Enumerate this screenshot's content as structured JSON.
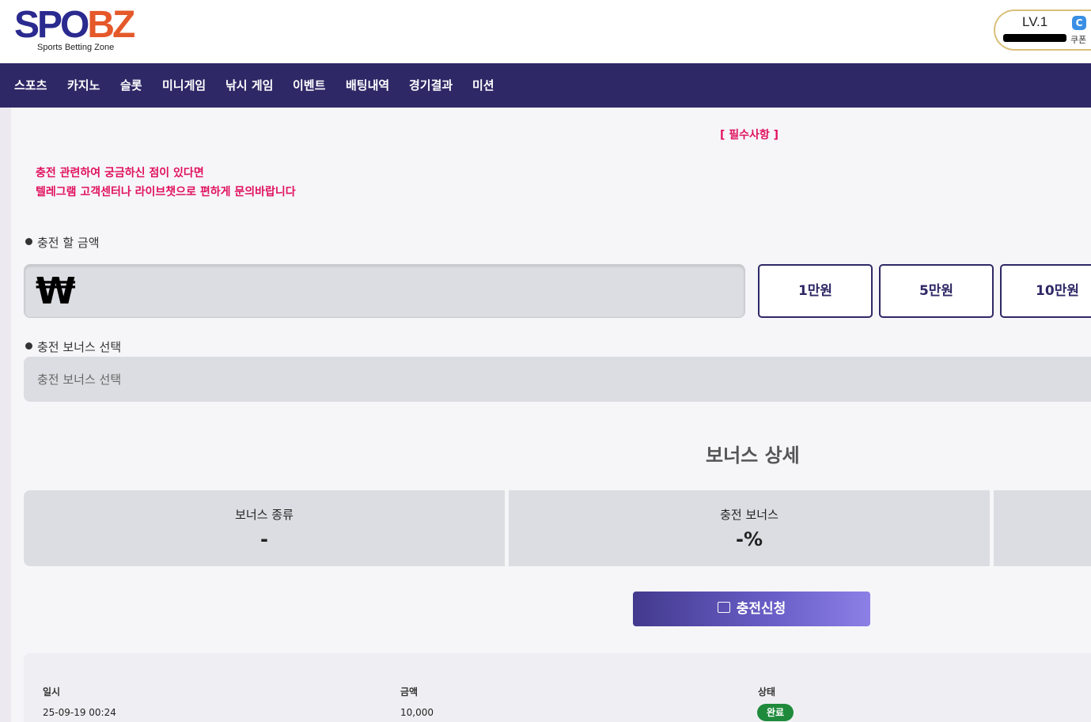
{
  "header": {
    "logo_part1": "SPO",
    "logo_part2": "BZ",
    "logo_subtitle": "Sports Betting Zone",
    "level": "LV.1",
    "coupon_label": "쿠폰",
    "coupon_icon": "coupon-icon"
  },
  "nav": {
    "items": [
      "스포츠",
      "카지노",
      "슬롯",
      "미니게임",
      "낚시 게임",
      "이벤트",
      "배팅내역",
      "경기결과",
      "미션"
    ]
  },
  "notice": {
    "required_title": "[ 필수사항 ]",
    "line1": "충전 관련하여 궁금하신 점이 있다면",
    "line2": "텔레그램 고객센터나 라이브챗으로 편하게 문의바랍니다"
  },
  "deposit": {
    "amount_label": "충전 할 금액",
    "currency_symbol": "₩",
    "quick_amounts": [
      "1만원",
      "5만원",
      "10만원"
    ],
    "bonus_label": "충전 보너스 선택",
    "bonus_placeholder": "충전 보너스 선택"
  },
  "bonus_detail": {
    "title": "보너스 상세",
    "columns": [
      {
        "header": "보너스 종류",
        "value": "-"
      },
      {
        "header": "충전 보너스",
        "value": "-%"
      },
      {
        "header": "",
        "value": ""
      }
    ]
  },
  "submit": {
    "label": "충전신청"
  },
  "history": {
    "headers": [
      "일시",
      "금액",
      "상태"
    ],
    "rows": [
      {
        "date": "25-09-19 00:24",
        "amount": "10,000",
        "status": "완료"
      }
    ]
  },
  "colors": {
    "nav_bg": "#2f2866",
    "notice_red": "#e0115f",
    "status_green": "#1f8a3b",
    "logo_blue": "#2b2a8f",
    "logo_orange": "#e5582a"
  }
}
